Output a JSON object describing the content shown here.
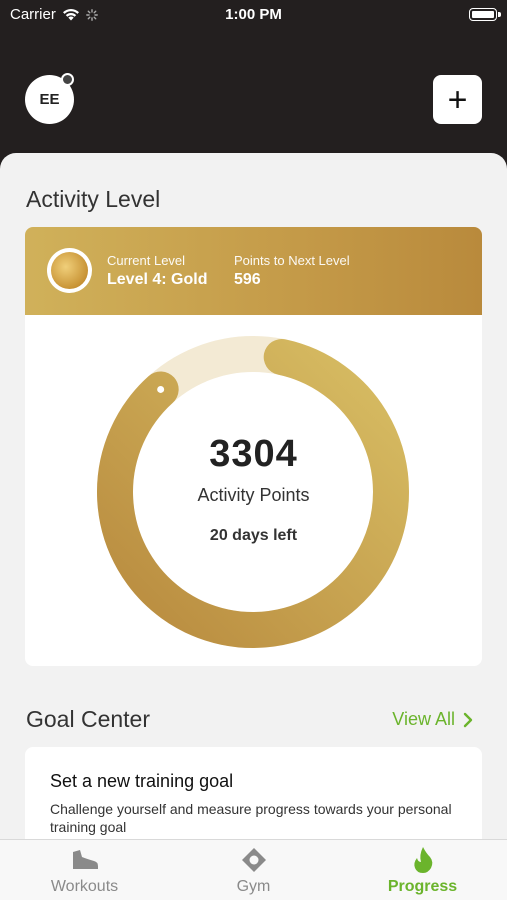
{
  "status_bar": {
    "carrier": "Carrier",
    "time": "1:00 PM"
  },
  "header": {
    "avatar_initials": "EE",
    "add_button_label": "+"
  },
  "activity": {
    "section_title": "Activity Level",
    "current_level_label": "Current Level",
    "current_level_value": "Level 4: Gold",
    "points_next_label": "Points to Next Level",
    "points_next_value": "596",
    "activity_points": "3304",
    "activity_points_label": "Activity Points",
    "days_left": "20 days left",
    "progress_fraction": 0.85,
    "colors": {
      "gold_start": "#d8be64",
      "gold_end": "#b88a3e",
      "track": "#f3ead4"
    }
  },
  "goal_center": {
    "section_title": "Goal Center",
    "view_all_label": "View All",
    "card_title": "Set a new training goal",
    "card_description": "Challenge yourself and measure progress towards your personal training goal"
  },
  "tabs": [
    {
      "label": "Workouts",
      "icon": "shoe-icon",
      "active": false
    },
    {
      "label": "Gym",
      "icon": "location-pin-icon",
      "active": false
    },
    {
      "label": "Progress",
      "icon": "flame-icon",
      "active": true
    }
  ],
  "colors": {
    "accent_green": "#6bb42c",
    "header_bg": "#231f1f"
  }
}
